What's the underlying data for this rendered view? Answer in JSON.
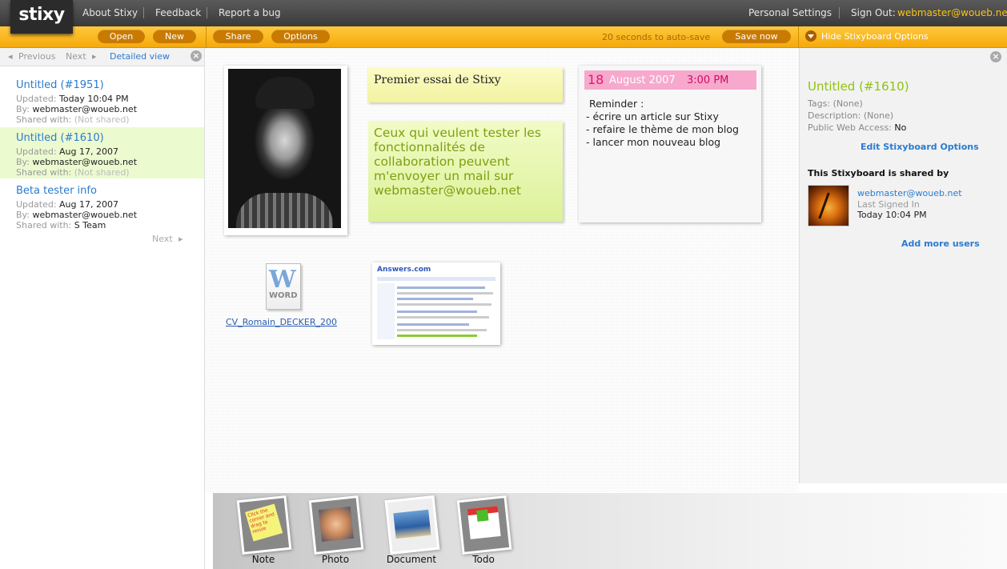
{
  "topbar": {
    "logo": "stixy",
    "links": [
      "About Stixy",
      "Feedback",
      "Report a bug"
    ],
    "personal_settings": "Personal Settings",
    "sign_out_label": "Sign Out:",
    "sign_out_email": "webmaster@woueb.net"
  },
  "toolbar": {
    "open": "Open",
    "new": "New",
    "share": "Share",
    "options": "Options",
    "autosave": "20 seconds to auto-save",
    "save_now": "Save now",
    "hide_options": "Hide Stixyboard Options"
  },
  "sidebar": {
    "prev": "Previous",
    "next": "Next",
    "detailed_view": "Detailed view",
    "close": "×",
    "bottom_next": "Next",
    "updated_label": "Updated:",
    "by_label": "By:",
    "shared_label": "Shared with:",
    "boards": [
      {
        "title": "Untitled (#1951)",
        "updated": "Today 10:04 PM",
        "by": "webmaster@woueb.net",
        "shared": "(Not shared)"
      },
      {
        "title": "Untitled (#1610)",
        "updated": "Aug 17, 2007",
        "by": "webmaster@woueb.net",
        "shared": "(Not shared)"
      },
      {
        "title": "Beta tester info",
        "updated": "Aug 17, 2007",
        "by": "webmaster@woueb.net",
        "shared": "S Team"
      }
    ]
  },
  "canvas": {
    "note1": "Premier essai de Stixy",
    "note2": "Ceux qui veulent tester les fonctionnalités de collaboration peuvent m'envoyer un mail sur webmaster@woueb.net",
    "todo": {
      "day": "18",
      "month": "August 2007",
      "time": "3:00 PM",
      "body": " Reminder :\n- écrire un article sur Stixy\n- refaire le thème de mon blog\n- lancer mon nouveau blog"
    },
    "word_file": {
      "icon_label": "WORD",
      "name": "CV_Romain_DECKER_200"
    },
    "web_brand": "Answers.com"
  },
  "rightpanel": {
    "close": "×",
    "title": "Untitled (#1610)",
    "tags_label": "Tags:",
    "tags": "(None)",
    "desc_label": "Description:",
    "desc": "(None)",
    "access_label": "Public Web Access:",
    "access": "No",
    "edit_link": "Edit Stixyboard Options",
    "shared_head": "This Stixyboard is shared by",
    "user_email": "webmaster@woueb.net",
    "user_label": "Last Signed In",
    "user_time": "Today 10:04 PM",
    "add_users": "Add more users"
  },
  "tray": {
    "note": "Note",
    "photo": "Photo",
    "document": "Document",
    "todo": "Todo",
    "note_hint": "Click the corner and drag to resize"
  },
  "colors": {
    "accent": "#f4a90b",
    "link": "#2a7bd0",
    "green": "#8fc30e"
  }
}
